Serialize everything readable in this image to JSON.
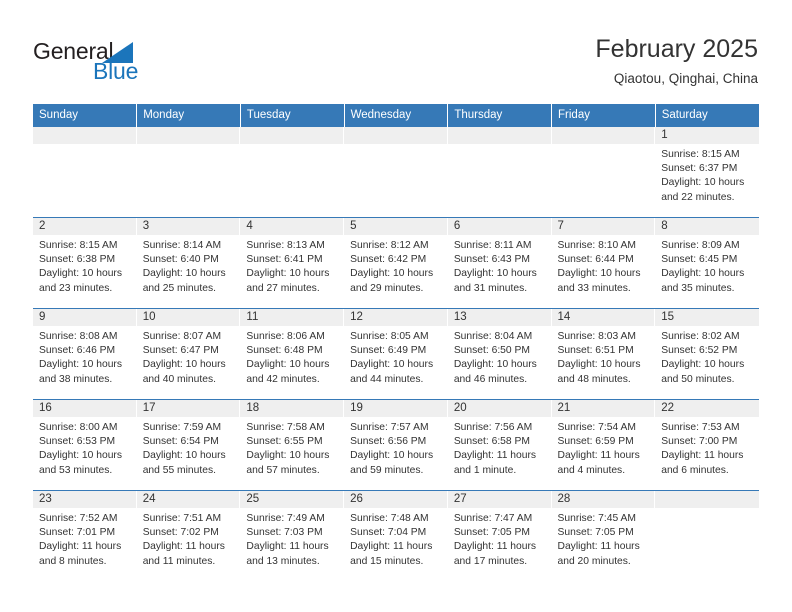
{
  "brand": {
    "name_part1": "General",
    "name_part2": "Blue",
    "triangle_color": "#1b75bb",
    "text_color": "#231f20"
  },
  "header": {
    "month_title": "February 2025",
    "location": "Qiaotou, Qinghai, China",
    "accent_color": "#3679b7",
    "daynum_band_color": "#efefef"
  },
  "weekday_headers": [
    "Sunday",
    "Monday",
    "Tuesday",
    "Wednesday",
    "Thursday",
    "Friday",
    "Saturday"
  ],
  "weeks": [
    [
      {
        "day": "",
        "sunrise": "",
        "sunset": "",
        "daylight": ""
      },
      {
        "day": "",
        "sunrise": "",
        "sunset": "",
        "daylight": ""
      },
      {
        "day": "",
        "sunrise": "",
        "sunset": "",
        "daylight": ""
      },
      {
        "day": "",
        "sunrise": "",
        "sunset": "",
        "daylight": ""
      },
      {
        "day": "",
        "sunrise": "",
        "sunset": "",
        "daylight": ""
      },
      {
        "day": "",
        "sunrise": "",
        "sunset": "",
        "daylight": ""
      },
      {
        "day": "1",
        "sunrise": "Sunrise: 8:15 AM",
        "sunset": "Sunset: 6:37 PM",
        "daylight": "Daylight: 10 hours and 22 minutes."
      }
    ],
    [
      {
        "day": "2",
        "sunrise": "Sunrise: 8:15 AM",
        "sunset": "Sunset: 6:38 PM",
        "daylight": "Daylight: 10 hours and 23 minutes."
      },
      {
        "day": "3",
        "sunrise": "Sunrise: 8:14 AM",
        "sunset": "Sunset: 6:40 PM",
        "daylight": "Daylight: 10 hours and 25 minutes."
      },
      {
        "day": "4",
        "sunrise": "Sunrise: 8:13 AM",
        "sunset": "Sunset: 6:41 PM",
        "daylight": "Daylight: 10 hours and 27 minutes."
      },
      {
        "day": "5",
        "sunrise": "Sunrise: 8:12 AM",
        "sunset": "Sunset: 6:42 PM",
        "daylight": "Daylight: 10 hours and 29 minutes."
      },
      {
        "day": "6",
        "sunrise": "Sunrise: 8:11 AM",
        "sunset": "Sunset: 6:43 PM",
        "daylight": "Daylight: 10 hours and 31 minutes."
      },
      {
        "day": "7",
        "sunrise": "Sunrise: 8:10 AM",
        "sunset": "Sunset: 6:44 PM",
        "daylight": "Daylight: 10 hours and 33 minutes."
      },
      {
        "day": "8",
        "sunrise": "Sunrise: 8:09 AM",
        "sunset": "Sunset: 6:45 PM",
        "daylight": "Daylight: 10 hours and 35 minutes."
      }
    ],
    [
      {
        "day": "9",
        "sunrise": "Sunrise: 8:08 AM",
        "sunset": "Sunset: 6:46 PM",
        "daylight": "Daylight: 10 hours and 38 minutes."
      },
      {
        "day": "10",
        "sunrise": "Sunrise: 8:07 AM",
        "sunset": "Sunset: 6:47 PM",
        "daylight": "Daylight: 10 hours and 40 minutes."
      },
      {
        "day": "11",
        "sunrise": "Sunrise: 8:06 AM",
        "sunset": "Sunset: 6:48 PM",
        "daylight": "Daylight: 10 hours and 42 minutes."
      },
      {
        "day": "12",
        "sunrise": "Sunrise: 8:05 AM",
        "sunset": "Sunset: 6:49 PM",
        "daylight": "Daylight: 10 hours and 44 minutes."
      },
      {
        "day": "13",
        "sunrise": "Sunrise: 8:04 AM",
        "sunset": "Sunset: 6:50 PM",
        "daylight": "Daylight: 10 hours and 46 minutes."
      },
      {
        "day": "14",
        "sunrise": "Sunrise: 8:03 AM",
        "sunset": "Sunset: 6:51 PM",
        "daylight": "Daylight: 10 hours and 48 minutes."
      },
      {
        "day": "15",
        "sunrise": "Sunrise: 8:02 AM",
        "sunset": "Sunset: 6:52 PM",
        "daylight": "Daylight: 10 hours and 50 minutes."
      }
    ],
    [
      {
        "day": "16",
        "sunrise": "Sunrise: 8:00 AM",
        "sunset": "Sunset: 6:53 PM",
        "daylight": "Daylight: 10 hours and 53 minutes."
      },
      {
        "day": "17",
        "sunrise": "Sunrise: 7:59 AM",
        "sunset": "Sunset: 6:54 PM",
        "daylight": "Daylight: 10 hours and 55 minutes."
      },
      {
        "day": "18",
        "sunrise": "Sunrise: 7:58 AM",
        "sunset": "Sunset: 6:55 PM",
        "daylight": "Daylight: 10 hours and 57 minutes."
      },
      {
        "day": "19",
        "sunrise": "Sunrise: 7:57 AM",
        "sunset": "Sunset: 6:56 PM",
        "daylight": "Daylight: 10 hours and 59 minutes."
      },
      {
        "day": "20",
        "sunrise": "Sunrise: 7:56 AM",
        "sunset": "Sunset: 6:58 PM",
        "daylight": "Daylight: 11 hours and 1 minute."
      },
      {
        "day": "21",
        "sunrise": "Sunrise: 7:54 AM",
        "sunset": "Sunset: 6:59 PM",
        "daylight": "Daylight: 11 hours and 4 minutes."
      },
      {
        "day": "22",
        "sunrise": "Sunrise: 7:53 AM",
        "sunset": "Sunset: 7:00 PM",
        "daylight": "Daylight: 11 hours and 6 minutes."
      }
    ],
    [
      {
        "day": "23",
        "sunrise": "Sunrise: 7:52 AM",
        "sunset": "Sunset: 7:01 PM",
        "daylight": "Daylight: 11 hours and 8 minutes."
      },
      {
        "day": "24",
        "sunrise": "Sunrise: 7:51 AM",
        "sunset": "Sunset: 7:02 PM",
        "daylight": "Daylight: 11 hours and 11 minutes."
      },
      {
        "day": "25",
        "sunrise": "Sunrise: 7:49 AM",
        "sunset": "Sunset: 7:03 PM",
        "daylight": "Daylight: 11 hours and 13 minutes."
      },
      {
        "day": "26",
        "sunrise": "Sunrise: 7:48 AM",
        "sunset": "Sunset: 7:04 PM",
        "daylight": "Daylight: 11 hours and 15 minutes."
      },
      {
        "day": "27",
        "sunrise": "Sunrise: 7:47 AM",
        "sunset": "Sunset: 7:05 PM",
        "daylight": "Daylight: 11 hours and 17 minutes."
      },
      {
        "day": "28",
        "sunrise": "Sunrise: 7:45 AM",
        "sunset": "Sunset: 7:05 PM",
        "daylight": "Daylight: 11 hours and 20 minutes."
      },
      {
        "day": "",
        "sunrise": "",
        "sunset": "",
        "daylight": ""
      }
    ]
  ]
}
